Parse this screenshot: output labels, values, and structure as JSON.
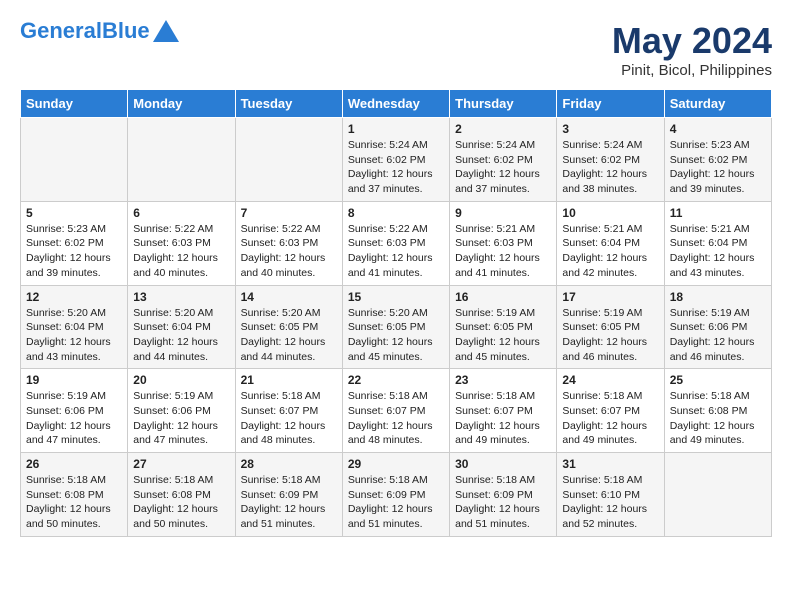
{
  "header": {
    "logo_general": "General",
    "logo_blue": "Blue",
    "month_year": "May 2024",
    "location": "Pinit, Bicol, Philippines"
  },
  "days_of_week": [
    "Sunday",
    "Monday",
    "Tuesday",
    "Wednesday",
    "Thursday",
    "Friday",
    "Saturday"
  ],
  "weeks": [
    [
      {
        "day": "",
        "info": ""
      },
      {
        "day": "",
        "info": ""
      },
      {
        "day": "",
        "info": ""
      },
      {
        "day": "1",
        "info": "Sunrise: 5:24 AM\nSunset: 6:02 PM\nDaylight: 12 hours and 37 minutes."
      },
      {
        "day": "2",
        "info": "Sunrise: 5:24 AM\nSunset: 6:02 PM\nDaylight: 12 hours and 37 minutes."
      },
      {
        "day": "3",
        "info": "Sunrise: 5:24 AM\nSunset: 6:02 PM\nDaylight: 12 hours and 38 minutes."
      },
      {
        "day": "4",
        "info": "Sunrise: 5:23 AM\nSunset: 6:02 PM\nDaylight: 12 hours and 39 minutes."
      }
    ],
    [
      {
        "day": "5",
        "info": "Sunrise: 5:23 AM\nSunset: 6:02 PM\nDaylight: 12 hours and 39 minutes."
      },
      {
        "day": "6",
        "info": "Sunrise: 5:22 AM\nSunset: 6:03 PM\nDaylight: 12 hours and 40 minutes."
      },
      {
        "day": "7",
        "info": "Sunrise: 5:22 AM\nSunset: 6:03 PM\nDaylight: 12 hours and 40 minutes."
      },
      {
        "day": "8",
        "info": "Sunrise: 5:22 AM\nSunset: 6:03 PM\nDaylight: 12 hours and 41 minutes."
      },
      {
        "day": "9",
        "info": "Sunrise: 5:21 AM\nSunset: 6:03 PM\nDaylight: 12 hours and 41 minutes."
      },
      {
        "day": "10",
        "info": "Sunrise: 5:21 AM\nSunset: 6:04 PM\nDaylight: 12 hours and 42 minutes."
      },
      {
        "day": "11",
        "info": "Sunrise: 5:21 AM\nSunset: 6:04 PM\nDaylight: 12 hours and 43 minutes."
      }
    ],
    [
      {
        "day": "12",
        "info": "Sunrise: 5:20 AM\nSunset: 6:04 PM\nDaylight: 12 hours and 43 minutes."
      },
      {
        "day": "13",
        "info": "Sunrise: 5:20 AM\nSunset: 6:04 PM\nDaylight: 12 hours and 44 minutes."
      },
      {
        "day": "14",
        "info": "Sunrise: 5:20 AM\nSunset: 6:05 PM\nDaylight: 12 hours and 44 minutes."
      },
      {
        "day": "15",
        "info": "Sunrise: 5:20 AM\nSunset: 6:05 PM\nDaylight: 12 hours and 45 minutes."
      },
      {
        "day": "16",
        "info": "Sunrise: 5:19 AM\nSunset: 6:05 PM\nDaylight: 12 hours and 45 minutes."
      },
      {
        "day": "17",
        "info": "Sunrise: 5:19 AM\nSunset: 6:05 PM\nDaylight: 12 hours and 46 minutes."
      },
      {
        "day": "18",
        "info": "Sunrise: 5:19 AM\nSunset: 6:06 PM\nDaylight: 12 hours and 46 minutes."
      }
    ],
    [
      {
        "day": "19",
        "info": "Sunrise: 5:19 AM\nSunset: 6:06 PM\nDaylight: 12 hours and 47 minutes."
      },
      {
        "day": "20",
        "info": "Sunrise: 5:19 AM\nSunset: 6:06 PM\nDaylight: 12 hours and 47 minutes."
      },
      {
        "day": "21",
        "info": "Sunrise: 5:18 AM\nSunset: 6:07 PM\nDaylight: 12 hours and 48 minutes."
      },
      {
        "day": "22",
        "info": "Sunrise: 5:18 AM\nSunset: 6:07 PM\nDaylight: 12 hours and 48 minutes."
      },
      {
        "day": "23",
        "info": "Sunrise: 5:18 AM\nSunset: 6:07 PM\nDaylight: 12 hours and 49 minutes."
      },
      {
        "day": "24",
        "info": "Sunrise: 5:18 AM\nSunset: 6:07 PM\nDaylight: 12 hours and 49 minutes."
      },
      {
        "day": "25",
        "info": "Sunrise: 5:18 AM\nSunset: 6:08 PM\nDaylight: 12 hours and 49 minutes."
      }
    ],
    [
      {
        "day": "26",
        "info": "Sunrise: 5:18 AM\nSunset: 6:08 PM\nDaylight: 12 hours and 50 minutes."
      },
      {
        "day": "27",
        "info": "Sunrise: 5:18 AM\nSunset: 6:08 PM\nDaylight: 12 hours and 50 minutes."
      },
      {
        "day": "28",
        "info": "Sunrise: 5:18 AM\nSunset: 6:09 PM\nDaylight: 12 hours and 51 minutes."
      },
      {
        "day": "29",
        "info": "Sunrise: 5:18 AM\nSunset: 6:09 PM\nDaylight: 12 hours and 51 minutes."
      },
      {
        "day": "30",
        "info": "Sunrise: 5:18 AM\nSunset: 6:09 PM\nDaylight: 12 hours and 51 minutes."
      },
      {
        "day": "31",
        "info": "Sunrise: 5:18 AM\nSunset: 6:10 PM\nDaylight: 12 hours and 52 minutes."
      },
      {
        "day": "",
        "info": ""
      }
    ]
  ]
}
